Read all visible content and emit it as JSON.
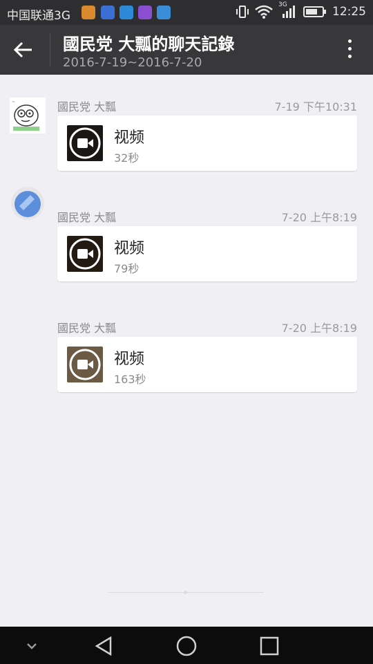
{
  "status_bar": {
    "carrier": "中国联通3G",
    "network_badge": "3G",
    "time": "12:25",
    "notification_colors": [
      "#d98a2e",
      "#3b6fd4",
      "#2d8ad9",
      "#8a4fd1",
      "#3a8ed8"
    ]
  },
  "header": {
    "title": "國民党 大瓢的聊天記錄",
    "subtitle": "2016-7-19~2016-7-20"
  },
  "messages": [
    {
      "sender": "國民党 大瓢",
      "time": "7-19 下午10:31",
      "type_label": "视频",
      "duration": "32秒"
    },
    {
      "sender": "國民党 大瓢",
      "time": "7-20 上午8:19",
      "type_label": "视频",
      "duration": "79秒"
    },
    {
      "sender": "國民党 大瓢",
      "time": "7-20 上午8:19",
      "type_label": "视频",
      "duration": "163秒"
    }
  ],
  "colors": {
    "accent_bg": "#38383b",
    "status_bg": "#2e2e30",
    "page_bg": "#efeff4",
    "avatar_blue": "#5b8fdc"
  }
}
